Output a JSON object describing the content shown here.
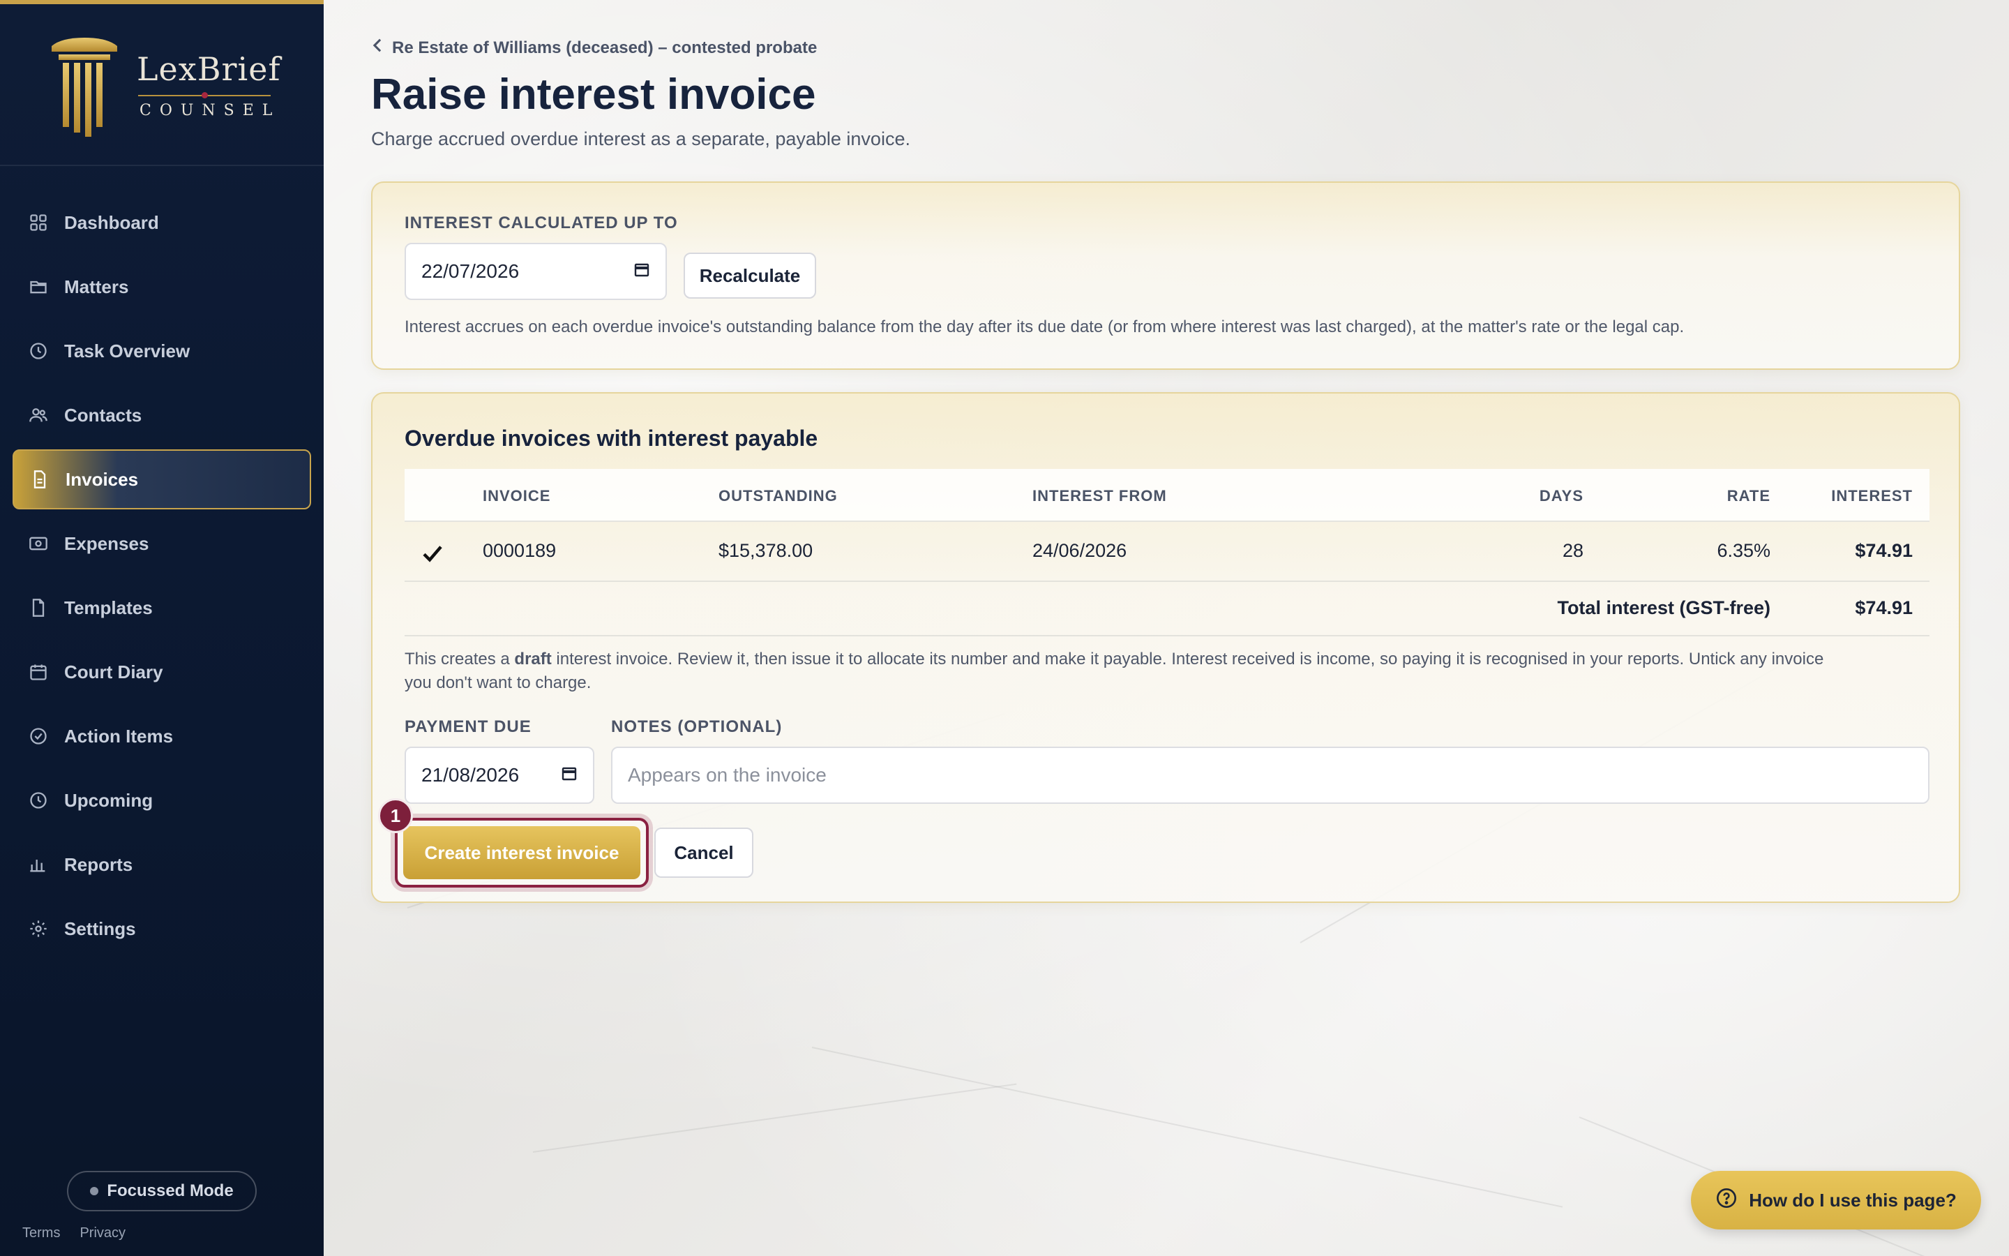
{
  "brand": {
    "name": "LexBrief",
    "sub": "COUNSEL"
  },
  "nav": [
    {
      "label": "Dashboard",
      "icon": "grid-icon"
    },
    {
      "label": "Matters",
      "icon": "folder-icon"
    },
    {
      "label": "Task Overview",
      "icon": "clock-icon"
    },
    {
      "label": "Contacts",
      "icon": "users-icon"
    },
    {
      "label": "Invoices",
      "icon": "document-icon",
      "active": true
    },
    {
      "label": "Expenses",
      "icon": "receipt-icon"
    },
    {
      "label": "Templates",
      "icon": "file-icon"
    },
    {
      "label": "Court Diary",
      "icon": "calendar-icon"
    },
    {
      "label": "Action Items",
      "icon": "check-circle-icon"
    },
    {
      "label": "Upcoming",
      "icon": "clock-icon"
    },
    {
      "label": "Reports",
      "icon": "bar-chart-icon"
    },
    {
      "label": "Settings",
      "icon": "gear-icon"
    }
  ],
  "focus_mode": "Focussed Mode",
  "footer": {
    "terms": "Terms",
    "privacy": "Privacy"
  },
  "breadcrumb": "Re Estate of Williams (deceased) – contested probate",
  "page": {
    "title": "Raise interest invoice",
    "subtitle": "Charge accrued overdue interest as a separate, payable invoice."
  },
  "calc": {
    "label": "INTEREST CALCULATED UP TO",
    "date": "22/07/2026",
    "recalc_button": "Recalculate",
    "help": "Interest accrues on each overdue invoice's outstanding balance from the day after its due date (or from where interest was last charged), at the matter's rate or the legal cap."
  },
  "overdue": {
    "title": "Overdue invoices with interest payable",
    "headers": {
      "invoice": "INVOICE",
      "outstanding": "OUTSTANDING",
      "interest_from": "INTEREST FROM",
      "days": "DAYS",
      "rate": "RATE",
      "interest": "INTEREST"
    },
    "rows": [
      {
        "checked": true,
        "invoice": "0000189",
        "outstanding": "$15,378.00",
        "interest_from": "24/06/2026",
        "days": "28",
        "rate": "6.35%",
        "interest": "$74.91"
      }
    ],
    "total_label": "Total interest (GST-free)",
    "total_value": "$74.91",
    "note_pre": "This creates a ",
    "note_bold": "draft",
    "note_post": " interest invoice. Review it, then issue it to allocate its number and make it payable. Interest received is income, so paying it is recognised in your reports. Untick any invoice",
    "note_line2": "you don't want to charge.",
    "payment_due_label": "PAYMENT DUE",
    "payment_due": "21/08/2026",
    "notes_label": "NOTES (OPTIONAL)",
    "notes_placeholder": "Appears on the invoice",
    "create_button": "Create interest invoice",
    "cancel_button": "Cancel",
    "step": "1"
  },
  "help_button": "How do I use this page?",
  "colors": {
    "navy": "#0e1c36",
    "gold": "#c9a24a",
    "burgundy": "#8a2141"
  }
}
